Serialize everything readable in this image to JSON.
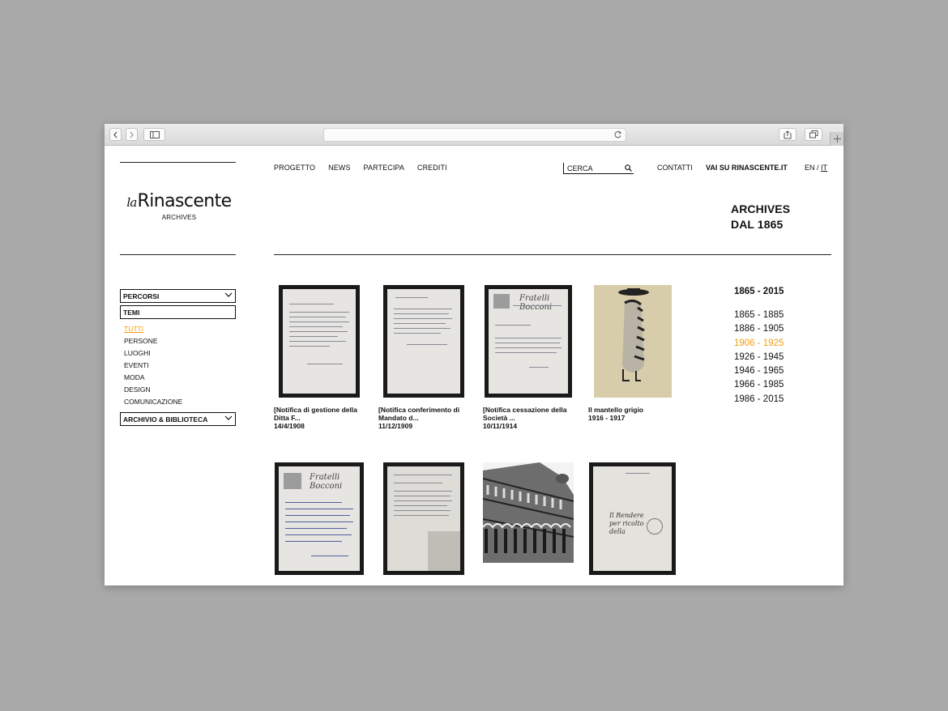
{
  "browser": {
    "url": ""
  },
  "header": {
    "brand_prefix": "la",
    "brand_name": "Rinascente",
    "brand_sub": "ARCHIVES",
    "nav": [
      "PROGETTO",
      "NEWS",
      "PARTECIPA",
      "CREDITI"
    ],
    "search_placeholder": "CERCA",
    "contatti": "CONTATTI",
    "vai_su": "VAI SU RINASCENTE.IT",
    "lang_en": "EN",
    "lang_sep": " / ",
    "lang_it": "IT",
    "title_line1": "ARCHIVES",
    "title_line2": "DAL 1865"
  },
  "sidebar": {
    "percorsi": "PERCORSI",
    "temi": "TEMI",
    "temi_items": [
      "TUTTI",
      "PERSONE",
      "LUOGHI",
      "EVENTI",
      "MODA",
      "DESIGN",
      "COMUNICAZIONE"
    ],
    "active_item": "TUTTI",
    "archivio": "ARCHIVIO & BIBLIOTECA"
  },
  "grid": [
    {
      "title": "[Notifica di gestione della Ditta F...",
      "date": "14/4/1908",
      "kind": "document"
    },
    {
      "title": "[Notifica conferimento di Mandato d...",
      "date": "11/12/1909",
      "kind": "document"
    },
    {
      "title": "[Notifica cessazione della Società ...",
      "date": "10/11/1914",
      "kind": "letterhead"
    },
    {
      "title": "Il mantello grigio",
      "date": "1916 - 1917",
      "kind": "illustration"
    },
    {
      "title": "",
      "date": "",
      "kind": "letterhead"
    },
    {
      "title": "",
      "date": "",
      "kind": "document"
    },
    {
      "title": "",
      "date": "",
      "kind": "photo"
    },
    {
      "title": "",
      "date": "",
      "kind": "document"
    }
  ],
  "timeline": {
    "range": "1865 - 2015",
    "periods": [
      "1865 - 1885",
      "1886 - 1905",
      "1906 - 1925",
      "1926 - 1945",
      "1946 - 1965",
      "1966 - 1985",
      "1986 - 2015"
    ],
    "active_period": "1906 - 1925"
  },
  "colors": {
    "accent": "#f39c12",
    "text": "#111111",
    "frame": "#1a1a1a"
  }
}
